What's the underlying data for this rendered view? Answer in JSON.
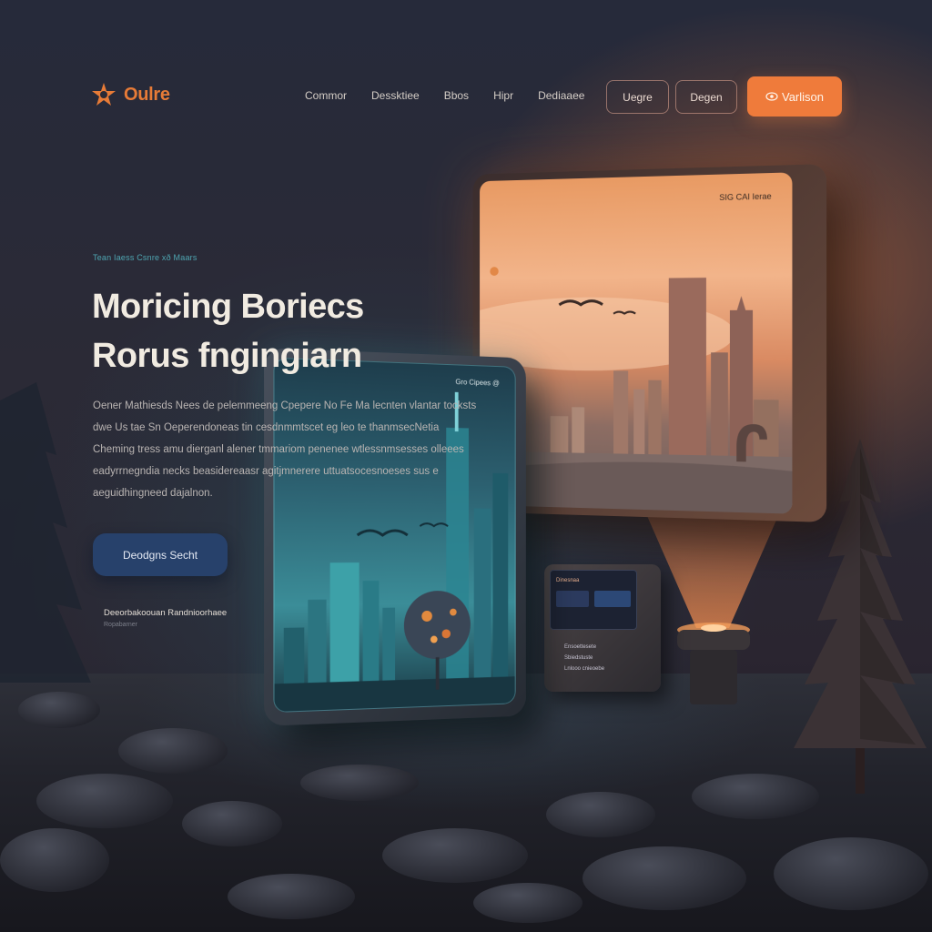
{
  "brand": {
    "name": "Oulre",
    "icon": "sun-star-icon",
    "accent": "#ef7b3b"
  },
  "nav": {
    "links": [
      "Commor",
      "Dessktiee",
      "Bbos",
      "Hipr",
      "Dediaaee"
    ],
    "secondary_buttons": [
      "Uegre",
      "Degen"
    ],
    "cta": {
      "label": "Varlison",
      "icon": "eye-icon"
    }
  },
  "hero": {
    "eyebrow": "Tean Iaess Csnre xð Maars",
    "headline": [
      "Moricing Boriecs",
      "Rorus fngingiarn"
    ],
    "body": [
      "Oener Mathiesds Nees de pelemmeeng Cpepere No Fe Ma lecnten vlantar tocksts",
      "dwe Us tae Sn Oeperendoneas tin cesdnmmtscet eg leo te thanmsecNetia",
      "Cheming tress amu dierganl alener tmmariom penenee wtlessnmsesses olleees",
      "eadyrrnegndia necks beasidereaasr agitjmnerere uttuatsocesnoeses sus e",
      "aeguidhingneed dajalnon."
    ],
    "cta_label": "Deodgns Secht",
    "meta_title": "Deeorbakoouan Randnioorhaee",
    "meta_sub": "Ropabarner"
  },
  "screens": {
    "back_label": "SIG  CAI Ierae",
    "front_label": "Gro  Cipees  @",
    "device_title": "Dinesnaa",
    "device_lines": [
      "Ensoettesete",
      "Sbiedstuste",
      "Lnlooo cnieoebe"
    ]
  }
}
